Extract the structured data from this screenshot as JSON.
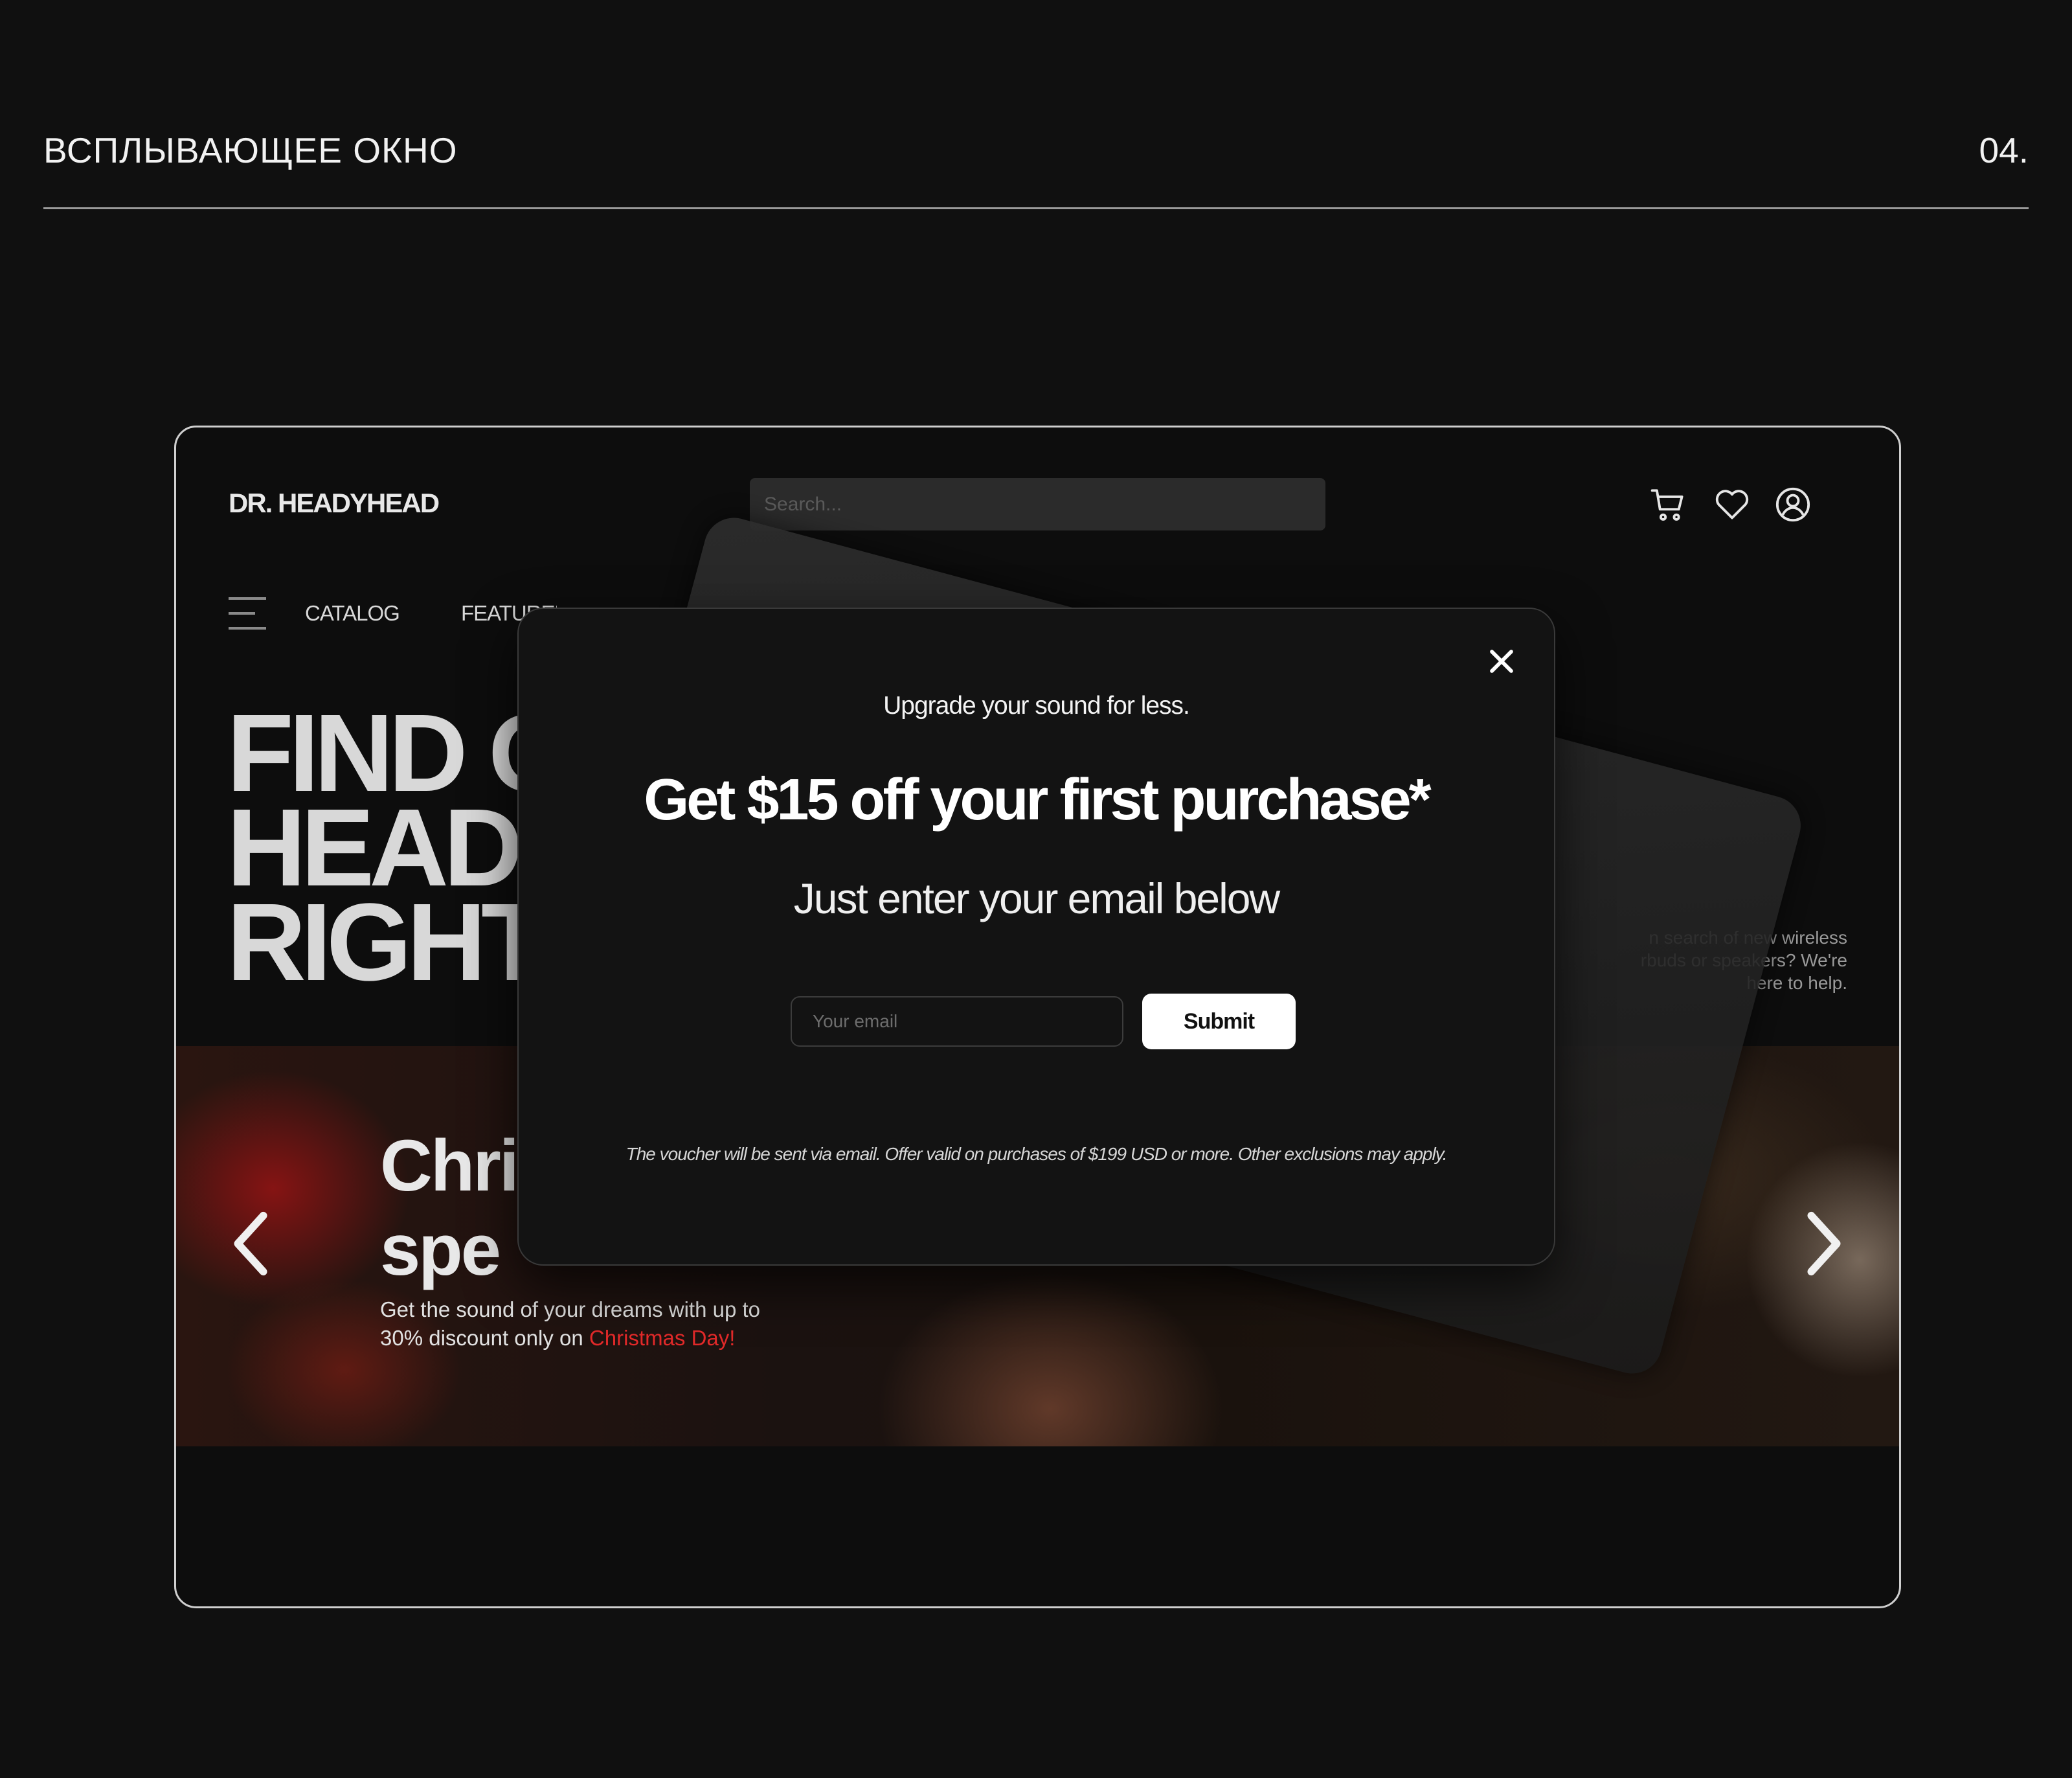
{
  "page": {
    "title": "ВСПЛЫВАЮЩЕЕ ОКНО",
    "number": "04."
  },
  "site": {
    "logo": "DR. HEADYHEAD",
    "search_placeholder": "Search...",
    "header_icons": [
      "cart-icon",
      "heart-icon",
      "user-icon"
    ],
    "nav": [
      "CATALOG",
      "FEATURED"
    ],
    "hero": {
      "line1": "FIND O",
      "line2": "HEAD",
      "line3": "RIGHT",
      "side_line1": "n search of new wireless",
      "side_line2": "rbuds or speakers? We're",
      "side_line3": "here to help."
    },
    "banner": {
      "heading_line1": "Chri",
      "heading_line2": "spe",
      "text_line1": "Get the sound of your dreams with up to",
      "text_line2_prefix": "30% discount only on ",
      "text_highlight": "Christmas Day!",
      "highlight_color": "#e32a2a"
    }
  },
  "modal": {
    "subtitle": "Upgrade your sound for less.",
    "title": "Get $15 off your first purchase*",
    "lead": "Just enter your email below",
    "email_placeholder": "Your email",
    "submit_label": "Submit",
    "disclaimer": "The voucher will be sent via email. Offer valid on purchases of $199 USD or more. Other exclusions may apply."
  }
}
